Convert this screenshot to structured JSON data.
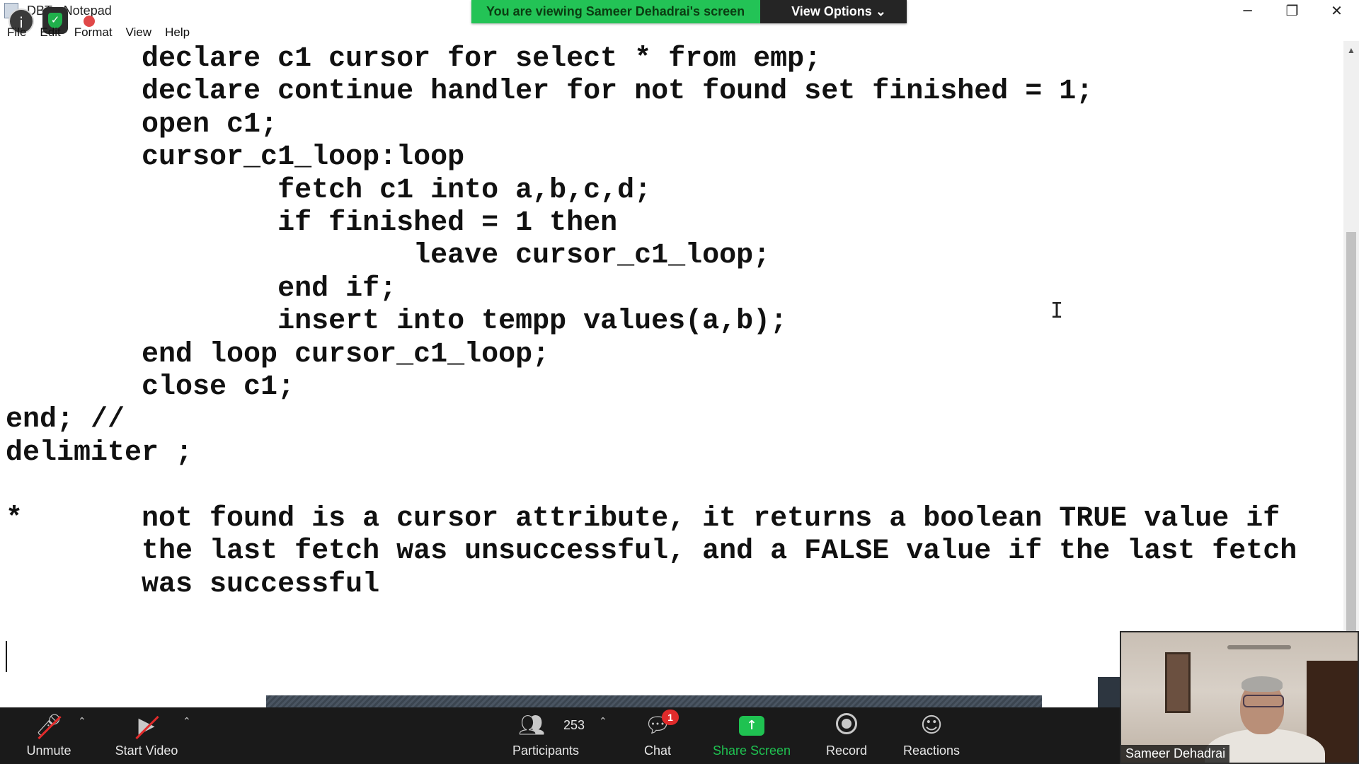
{
  "window": {
    "title": "DBT - Notepad",
    "menu": [
      "File",
      "Edit",
      "Format",
      "View",
      "Help"
    ],
    "controls": [
      "minimize-icon",
      "restore-icon",
      "close-icon"
    ]
  },
  "share_banner": {
    "message": "You are viewing Sameer Dehadrai's screen",
    "options_label": "View Options ⌄"
  },
  "editor": {
    "lines": [
      "        declare c1 cursor for select * from emp;",
      "        declare continue handler for not found set finished = 1;",
      "        open c1;",
      "        cursor_c1_loop:loop",
      "                fetch c1 into a,b,c,d;",
      "                if finished = 1 then",
      "                        leave cursor_c1_loop;",
      "                end if;",
      "                insert into tempp values(a,b);",
      "        end loop cursor_c1_loop;",
      "        close c1;",
      "end; //",
      "delimiter ;",
      "",
      "*       not found is a cursor attribute, it returns a boolean TRUE value if",
      "        the last fetch was unsuccessful, and a FALSE value if the last fetch",
      "        was successful"
    ]
  },
  "toolbar": {
    "unmute_label": "Unmute",
    "start_video_label": "Start Video",
    "participants_label": "Participants",
    "participants_count": "253",
    "chat_label": "Chat",
    "chat_badge": "1",
    "share_screen_label": "Share Screen",
    "record_label": "Record",
    "reactions_label": "Reactions"
  },
  "video_tile": {
    "name": "Sameer Dehadrai"
  },
  "colors": {
    "banner_green": "#23c356",
    "share_green": "#1fc251",
    "badge_red": "#e02b2b",
    "toolbar_bg": "#1a1a1a"
  }
}
